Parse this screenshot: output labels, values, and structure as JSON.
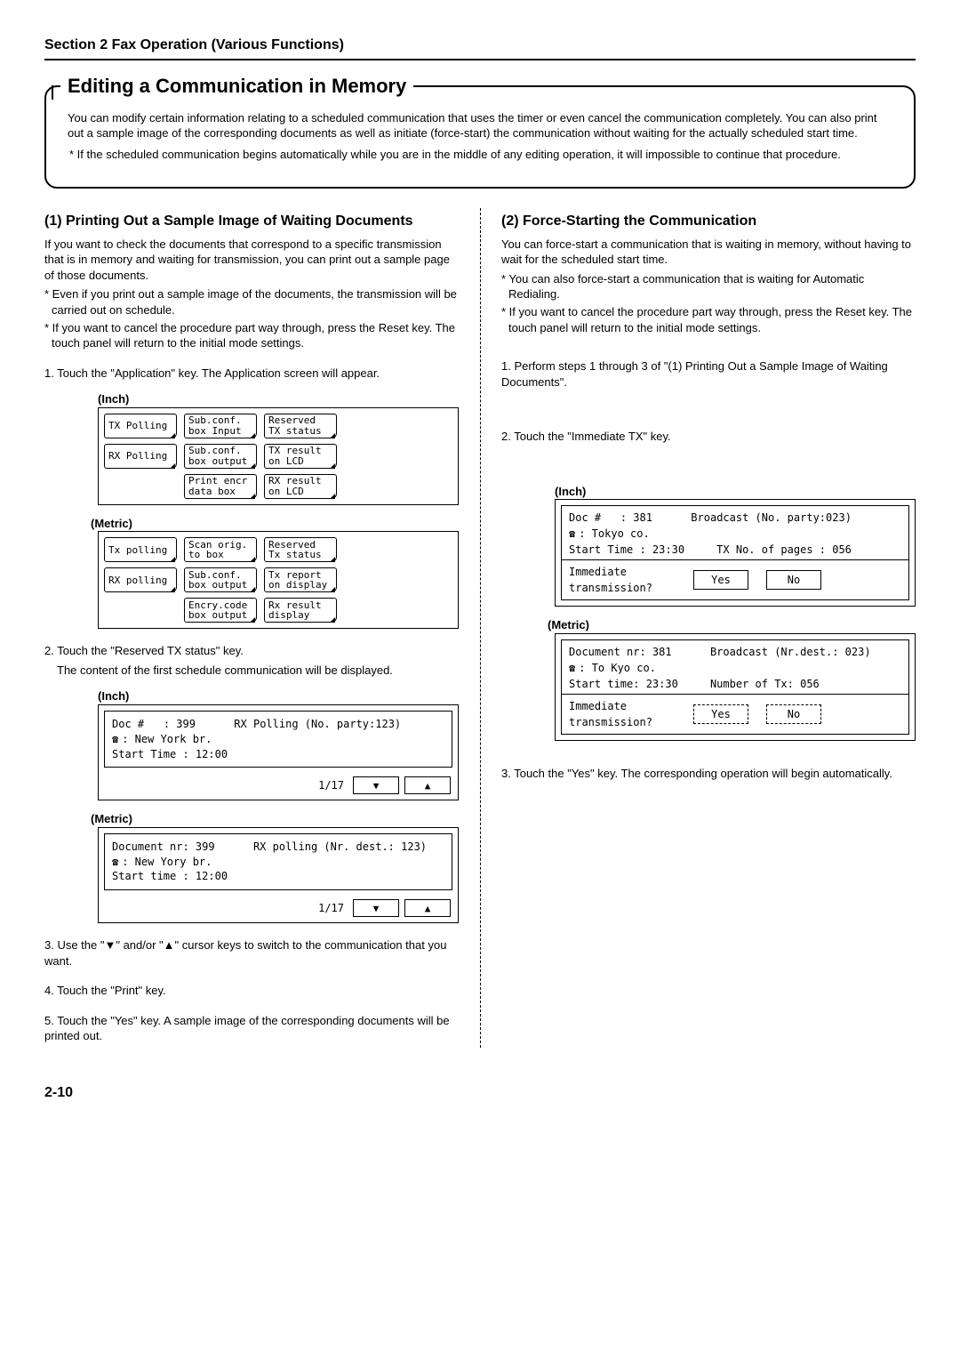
{
  "header": "Section 2  Fax Operation (Various Functions)",
  "title": "Editing a Communication in Memory",
  "intro": {
    "p1": "You can modify certain information relating to a scheduled communication that uses the timer or even cancel the communication completely. You can also print out a sample image of the corresponding documents as well as initiate (force-start) the communication without waiting for the actually scheduled start time.",
    "p2": "* If the scheduled communication begins automatically while you are in the middle of any editing operation, it will impossible to continue that procedure."
  },
  "left": {
    "h": "(1) Printing Out a Sample Image of Waiting Documents",
    "p1": "If you want to check the documents that correspond to a specific transmission that is in memory and waiting for transmission, you can print out a sample page of those documents.",
    "n1": "* Even if you print out a sample image of the documents, the transmission will be carried out on schedule.",
    "n2": "* If you want to cancel the procedure part way through, press the Reset key. The touch panel will return to the initial mode settings.",
    "s1": "1. Touch the \"Application\" key. The Application screen will appear.",
    "inchLabel": "(Inch)",
    "metricLabel": "(Metric)",
    "lcd_inch": {
      "r1c1a": "TX Polling",
      "r1c2a": "Sub.conf.",
      "r1c2b": "box Input",
      "r1c3a": "Reserved",
      "r1c3b": "TX status",
      "r2c1a": "RX Polling",
      "r2c2a": "Sub.conf.",
      "r2c2b": "box output",
      "r2c3a": "TX result",
      "r2c3b": "on LCD",
      "r3c2a": "Print encr",
      "r3c2b": "data box",
      "r3c3a": "RX result",
      "r3c3b": "on LCD"
    },
    "lcd_metric": {
      "r1c1a": "Tx polling",
      "r1c2a": "Scan orig.",
      "r1c2b": "to box",
      "r1c3a": "Reserved",
      "r1c3b": "Tx status",
      "r2c1a": "RX polling",
      "r2c2a": "Sub.conf.",
      "r2c2b": "box output",
      "r2c3a": "Tx report",
      "r2c3b": "on display",
      "r3c2a": "Encry.code",
      "r3c2b": "box output",
      "r3c3a": "Rx result",
      "r3c3b": "display"
    },
    "s2": "2. Touch the \"Reserved TX status\" key.",
    "s2b": "The content of the first schedule communication will be displayed.",
    "status_inch": {
      "doc_label": "Doc #",
      "doc_val": ": 399",
      "op": "RX Polling  (No. party:123)",
      "dest": ": New York br.",
      "time": "Start Time : 12:00",
      "page": "1/17"
    },
    "status_metric": {
      "doc_label": "Document nr: 399",
      "op": "RX polling  (Nr. dest.: 123)",
      "dest": ": New Yory br.",
      "time": "Start time : 12:00",
      "page": "1/17"
    },
    "s3": "3. Use the \"▼\" and/or \"▲\" cursor keys to switch to the communication that you want.",
    "s4": "4. Touch the \"Print\" key.",
    "s5": "5. Touch the \"Yes\" key. A sample image of the corresponding documents will be printed out."
  },
  "right": {
    "h": "(2) Force-Starting the Communication",
    "p1": "You can force-start a communication that is waiting in memory, without having to wait for the scheduled start time.",
    "n1": "* You can also force-start a communication that is waiting for Automatic Redialing.",
    "n2": "* If you want to cancel the procedure part way through, press the Reset key. The touch panel will return to the initial mode settings.",
    "s1": "1. Perform steps 1 through 3 of \"(1) Printing Out a Sample Image of Waiting Documents\".",
    "s2": "2. Touch the \"Immediate TX\" key.",
    "inchLabel": "(Inch)",
    "metricLabel": "(Metric)",
    "lcd_inch": {
      "doc_label": "Doc #",
      "doc_val": ": 381",
      "op": "Broadcast (No. party:023)",
      "dest": ": Tokyo co.",
      "time": "Start Time : 23:30",
      "pages": "TX No. of pages : 056",
      "qn1": "Immediate",
      "qn2": "transmission?",
      "yes": "Yes",
      "no": "No"
    },
    "lcd_metric": {
      "doc_label": "Document nr: 381",
      "op": "Broadcast  (Nr.dest.: 023)",
      "dest": ": To Kyo co.",
      "time": "Start time: 23:30",
      "pages": "Number of Tx: 056",
      "qn1": "Immediate",
      "qn2": "transmission?",
      "yes": "Yes",
      "no": "No"
    },
    "s3": "3. Touch the \"Yes\" key. The corresponding operation will begin automatically."
  },
  "pageNumber": "2-10"
}
